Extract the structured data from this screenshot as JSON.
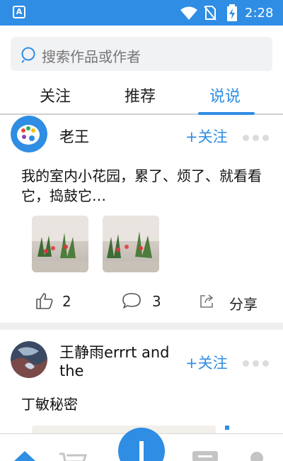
{
  "status_bar": {
    "notification_letter": "A",
    "time": "2:28",
    "icons": [
      "app-notification-icon",
      "wifi-icon",
      "no-sim-icon",
      "battery-charging-icon"
    ]
  },
  "search": {
    "placeholder": "搜索作品或作者",
    "icon": "search-icon"
  },
  "tabs": [
    {
      "label": "关注"
    },
    {
      "label": "推荐"
    },
    {
      "label": "说说",
      "active": true
    }
  ],
  "posts": [
    {
      "author": "老王",
      "follow_label": "+关注",
      "text": "我的室内小花园，累了、烦了、就看看它，捣鼓它…",
      "images": [
        "plant-photo",
        "plant-photo"
      ],
      "likes": "2",
      "comments": "3",
      "share_label": "分享"
    },
    {
      "author": "王静雨errrt and the",
      "follow_label": "+关注",
      "text": "丁敏秘密"
    }
  ],
  "bottom_nav": {
    "items": [
      "home-icon",
      "cart-icon",
      "add-icon",
      "message-icon",
      "profile-icon"
    ]
  },
  "colors": {
    "accent": "#2f8de4",
    "status_bar": "#2f8de4"
  }
}
